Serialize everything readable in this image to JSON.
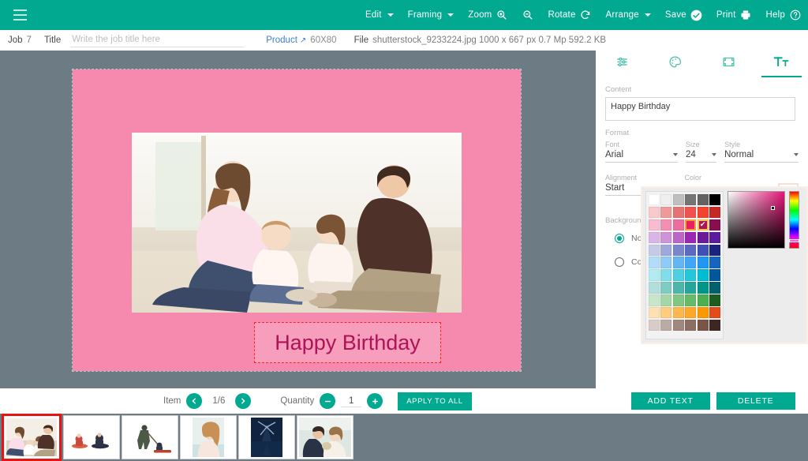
{
  "toolbar": {
    "menu_icon": "hamburger-icon",
    "items": [
      {
        "label": "Edit",
        "icon": "chevron-down-icon",
        "type": "dropdown"
      },
      {
        "label": "Framing",
        "icon": "chevron-down-icon",
        "type": "dropdown"
      },
      {
        "label": "Zoom",
        "icon": "zoom-in-icon",
        "type": "zoom"
      },
      {
        "label": "",
        "icon": "zoom-out-icon",
        "type": "zoomout"
      },
      {
        "label": "Rotate",
        "icon": "rotate-icon",
        "type": "action"
      },
      {
        "label": "Arrange",
        "icon": "chevron-down-icon",
        "type": "dropdown"
      },
      {
        "label": "Save",
        "icon": "check-circle-icon",
        "type": "action"
      },
      {
        "label": "Print",
        "icon": "printer-icon",
        "type": "action"
      },
      {
        "label": "Help",
        "icon": "question-circle-icon",
        "type": "action"
      }
    ],
    "background_color": "#00a98f"
  },
  "jobbar": {
    "job_label": "Job",
    "job_number": "7",
    "title_label": "Title",
    "title_value": "",
    "title_placeholder": "Write the job title here",
    "product_label": "Product",
    "product_size": "60X80",
    "file_label": "File",
    "file_info": "shutterstock_9233224.jpg 1000 x 667 px 0.7 Mp 592.2 KB"
  },
  "canvas": {
    "mat_color": "#f589ae",
    "text_overlay": "Happy Birthday",
    "text_color": "rgb(173, 20, 87)",
    "workspace_background": "#6d7b85"
  },
  "controls": {
    "item_label": "Item",
    "prev_icon": "chevron-left-icon",
    "next_icon": "chevron-right-icon",
    "pager": "1/6",
    "quantity_label": "Quantity",
    "minus_icon": "minus-icon",
    "plus_icon": "plus-icon",
    "quantity_value": "1",
    "apply_to_all": "APPLY TO ALL",
    "add_text": "ADD TEXT",
    "delete": "DELETE",
    "button_color": "#00a98f"
  },
  "thumbnails": {
    "selected_index": 0,
    "selected_border_color": "#e81414",
    "items": [
      {
        "name": "family-reading-photo"
      },
      {
        "name": "sledding-two-kids-photo"
      },
      {
        "name": "sledding-parent-child-photo"
      },
      {
        "name": "woman-portrait-photo"
      },
      {
        "name": "windmill-photo"
      },
      {
        "name": "wedding-couple-photo"
      }
    ]
  },
  "panel": {
    "tabs": [
      {
        "name": "adjust-tab",
        "icon": "sliders-icon",
        "active": false
      },
      {
        "name": "color-tab",
        "icon": "palette-icon",
        "active": false
      },
      {
        "name": "frame-tab",
        "icon": "frame-icon",
        "active": false
      },
      {
        "name": "text-tab",
        "icon": "text-icon",
        "active": true
      }
    ],
    "content_label": "Content",
    "content_value": "Happy Birthday",
    "format_label": "Format",
    "font_label": "Font",
    "font_value": "Arial",
    "size_label": "Size",
    "size_value": "24",
    "style_label": "Style",
    "style_value": "Normal",
    "alignment_label": "Alignment",
    "alignment_value": "Start",
    "color_label": "Color",
    "color_value": "rgb(173, 20, 87)",
    "color_swatch": "#ad1457",
    "background_label": "Background",
    "background_options": [
      {
        "label": "No background",
        "selected": true
      },
      {
        "label": "Color",
        "selected": false
      }
    ]
  },
  "color_picker": {
    "selected_swatch": {
      "row": 2,
      "col": 4,
      "hex": "#ad1457"
    },
    "check_icon": "check-icon",
    "palette_rows": [
      [
        "#ffffff",
        "#efefef",
        "#bfbfbf",
        "#757575",
        "#636363",
        "#000000"
      ],
      [
        "#f9c9cb",
        "#ef9a9a",
        "#e57373",
        "#ef5350",
        "#f4442f",
        "#c62828"
      ],
      [
        "#f8bbd0",
        "#f48fb1",
        "#ec6e9e",
        "#e91e63",
        "#ad1457",
        "#880e4f"
      ],
      [
        "#dab6e8",
        "#ce93d8",
        "#ba68c8",
        "#9c27b0",
        "#6a1b9a",
        "#5c1b9e"
      ],
      [
        "#c5cae9",
        "#9fa8da",
        "#7986cb",
        "#5c6bc0",
        "#3f51b5",
        "#1a237e"
      ],
      [
        "#b3dcfb",
        "#90caf9",
        "#64b5f6",
        "#42a5f5",
        "#2196f3",
        "#1565c0"
      ],
      [
        "#b2ebf2",
        "#80deea",
        "#4dd0e1",
        "#26c6da",
        "#00bcd4",
        "#01579b"
      ],
      [
        "#b2dfdb",
        "#80cbc4",
        "#4db6ac",
        "#26a69a",
        "#009688",
        "#00606b"
      ],
      [
        "#c8e6c9",
        "#a5d6a7",
        "#81c784",
        "#66bb6a",
        "#4caf50",
        "#1b5e20"
      ],
      [
        "#ffe0b2",
        "#ffcc80",
        "#ffb74d",
        "#ffa726",
        "#ff9800",
        "#e64a19"
      ],
      [
        "#d7ccc8",
        "#bcaaa4",
        "#a1887f",
        "#8d6e63",
        "#795548",
        "#3e2723"
      ]
    ],
    "gradient_base": "rgb(232, 20, 120)"
  }
}
